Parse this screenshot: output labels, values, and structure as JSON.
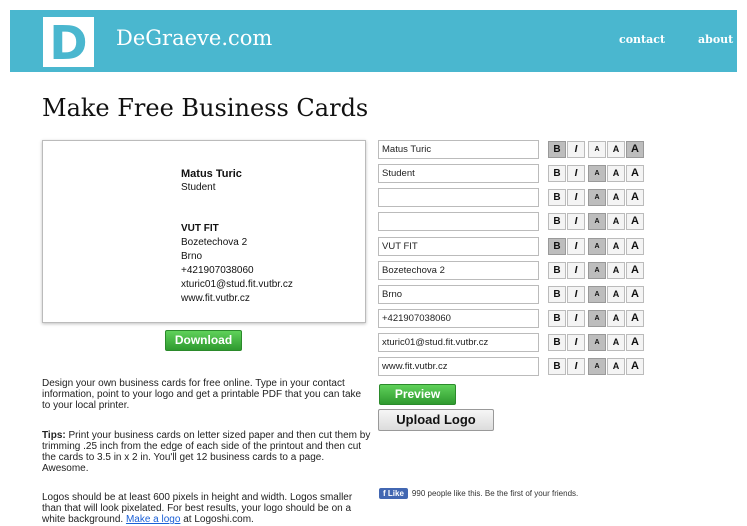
{
  "header": {
    "logo_letter": "D",
    "site_name": "DeGraeve.com",
    "nav": [
      "contact",
      "about"
    ]
  },
  "page": {
    "title": "Make Free Business Cards"
  },
  "card": {
    "name": "Matus Turic",
    "job_title": "Student",
    "company": "VUT FIT",
    "address": "Bozetechova 2",
    "city": "Brno",
    "phone": "+421907038060",
    "email": "xturic01@stud.fit.vutbr.cz",
    "website": "www.fit.vutbr.cz"
  },
  "buttons": {
    "download": "Download",
    "preview": "Preview",
    "upload_logo": "Upload Logo"
  },
  "format_labels": {
    "bold": "B",
    "italic": "I",
    "size": "A"
  },
  "fields": [
    {
      "value": "Matus Turic",
      "bold": true,
      "size": "large"
    },
    {
      "value": "Student",
      "bold": false,
      "size": "small"
    },
    {
      "value": "",
      "bold": false,
      "size": "small"
    },
    {
      "value": "",
      "bold": false,
      "size": "small"
    },
    {
      "value": "VUT FIT",
      "bold": true,
      "size": "small"
    },
    {
      "value": "Bozetechova 2",
      "bold": false,
      "size": "small"
    },
    {
      "value": "Brno",
      "bold": false,
      "size": "small"
    },
    {
      "value": "+421907038060",
      "bold": false,
      "size": "small"
    },
    {
      "value": "xturic01@stud.fit.vutbr.cz",
      "bold": false,
      "size": "small"
    },
    {
      "value": "www.fit.vutbr.cz",
      "bold": false,
      "size": "small"
    }
  ],
  "text": {
    "intro": "Design your own business cards for free online. Type in your contact information, point to your logo and get a printable PDF that you can take to your local printer.",
    "tips_label": "Tips:",
    "tips_body": "Print your business cards on letter sized paper and then cut them by trimming .25 inch from the edge of each side of the printout and then cut the cards to 3.5 in x 2 in. You'll get 12 business cards to a page. Awesome.",
    "logos_body": "Logos should be at least 600 pixels in height and width. Logos smaller than that will look pixelated. For best results, your logo should be on a white background.",
    "logo_link": "Make a logo",
    "logo_suffix": "at Logoshi.com."
  },
  "facebook": {
    "like_label": "Like",
    "like_text": "990 people like this. Be the first of your friends."
  },
  "colors": {
    "header_bg": "#4ab7cf",
    "accent_green": "#3aa53a",
    "link_blue": "#1a5fd6",
    "facebook_blue": "#4267b2"
  }
}
